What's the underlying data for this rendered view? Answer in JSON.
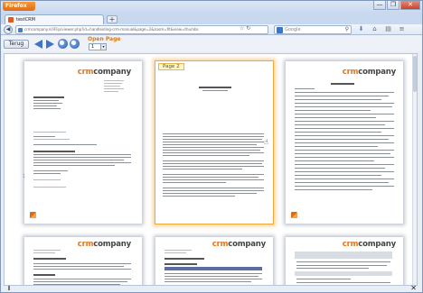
{
  "browser": {
    "menu_label": "Firefox",
    "tab_title": "testCRM",
    "new_tab_label": "+",
    "url": "crmcompany.nl/iFlip/viewer.php?id=handleiding-crm-manual&page=2&zoom=fit&view=thumbs",
    "search_placeholder": "Google",
    "window_controls": [
      "—",
      "❐",
      "✕"
    ],
    "nav_icons": [
      "star-icon",
      "reload-icon",
      "home-icon",
      "download-icon",
      "bookmarks-icon"
    ]
  },
  "viewer": {
    "back_label": "Terug",
    "open_label": "Open Page",
    "page_value": "1",
    "page_indicator": "1"
  },
  "pages": [
    {
      "label": "",
      "logo_prefix": "crm",
      "logo_suffix": "company"
    },
    {
      "label": "Page 2",
      "logo_prefix": "",
      "logo_suffix": ""
    },
    {
      "label": "",
      "logo_prefix": "crm",
      "logo_suffix": "company"
    },
    {
      "label": "",
      "logo_prefix": "crm",
      "logo_suffix": "company"
    },
    {
      "label": "",
      "logo_prefix": "crm",
      "logo_suffix": "company"
    },
    {
      "label": "",
      "logo_prefix": "crm",
      "logo_suffix": "company"
    }
  ],
  "colors": {
    "accent": "#e2761a",
    "selection": "#f0a93b",
    "link_blue": "#3f73c4"
  }
}
